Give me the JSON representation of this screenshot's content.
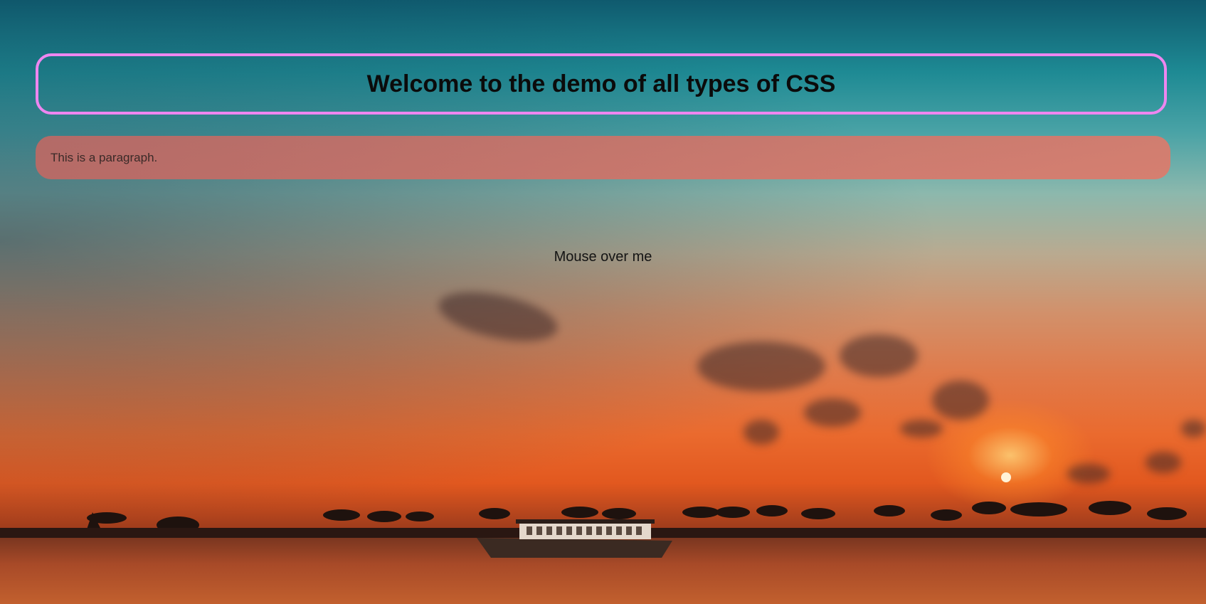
{
  "page": {
    "heading": "Welcome to the demo of all types of CSS",
    "paragraph": "This is a paragraph.",
    "hover_text": "Mouse over me"
  },
  "colors": {
    "heading_border": "#ee86f0",
    "paragraph_bg": "#d8786a",
    "text": "#0b0b0b"
  },
  "background": {
    "description_icon": "sunset-sea-boat-image"
  }
}
